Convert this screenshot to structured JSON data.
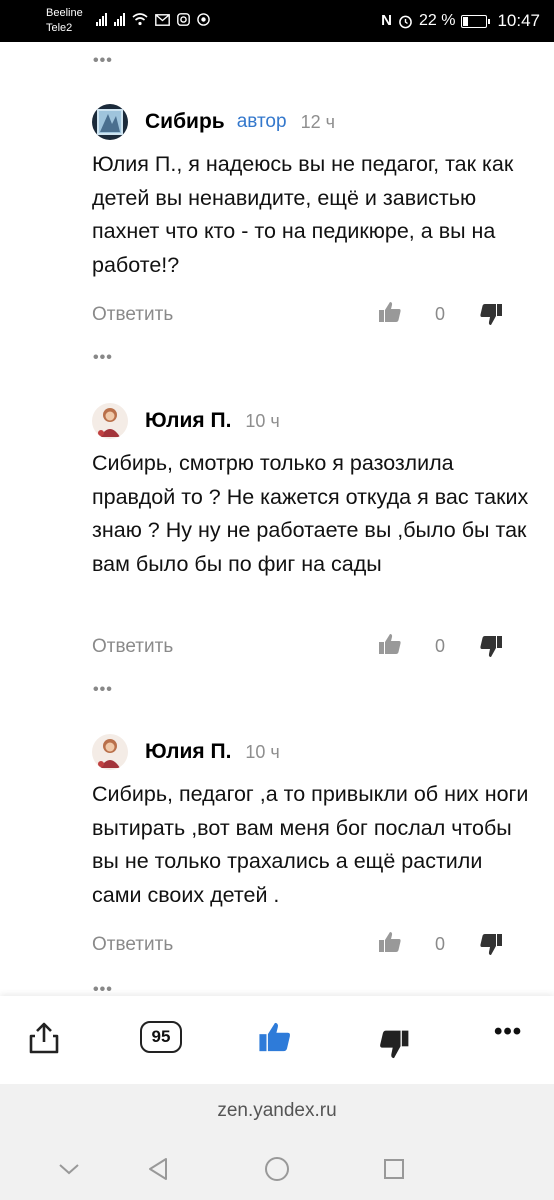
{
  "status_bar": {
    "carrier_1": "Beeline",
    "carrier_2": "Tele2",
    "battery_percent": "22 %",
    "battery_level": 0.22,
    "time": "10:47",
    "nfc_icon": "N"
  },
  "comments": [
    {
      "author": "Сибирь",
      "badge": "автор",
      "time": "12 ч",
      "text": "Юлия П., я надеюсь вы не педагог, так как детей вы ненавидите, ещё и завистью пахнет что кто - то на педикюре, а вы на работе!?",
      "reply_label": "Ответить",
      "likes": "0"
    },
    {
      "author": "Юлия П.",
      "badge": "",
      "time": "10 ч",
      "text": "Сибирь, смотрю только я разозлила правдой то ? Не кажется откуда я вас таких знаю ? Ну ну не работаете вы ,было бы так вам было бы по фиг на сады",
      "reply_label": "Ответить",
      "likes": "0"
    },
    {
      "author": "Юлия П.",
      "badge": "",
      "time": "10 ч",
      "text": "Сибирь, педагог ,а то привыкли об них ноги вытирать ,вот вам меня бог послал чтобы вы не только трахались а ещё растили сами своих детей .",
      "reply_label": "Ответить",
      "likes": "0"
    }
  ],
  "bottom_bar": {
    "comments_count": "95",
    "share_icon": "share-icon",
    "like_icon": "thumbs-up-icon",
    "dislike_icon": "thumbs-down-icon",
    "menu_icon": "more-icon"
  },
  "url_bar": {
    "url": "zen.yandex.ru"
  },
  "colors": {
    "accent_blue": "#2e7bd9",
    "author_badge": "#3478cc",
    "muted_text": "#8a8a8a"
  }
}
